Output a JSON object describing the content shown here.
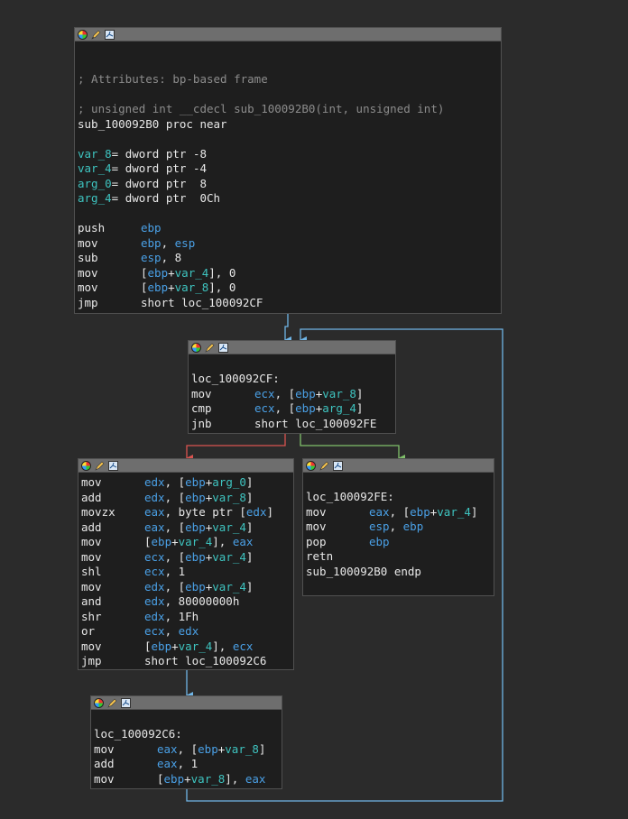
{
  "colors": {
    "background": "#2b2b2b",
    "block_bg": "#1e1e1e",
    "header_bg": "#6e6e6e",
    "comment": "#8c8c8c",
    "register": "#4aa0e6",
    "variable": "#3ec4c0",
    "edge_true": "#7fbf6a",
    "edge_false": "#d9534f",
    "edge_flow": "#6fb5e6"
  },
  "header_icons": [
    "color-picker-icon",
    "rename-icon",
    "graph-icon"
  ],
  "blocks": {
    "entry": {
      "comment_attr": "; Attributes: bp-based frame",
      "comment_sig": "; unsigned int __cdecl sub_100092B0(int, unsigned int)",
      "proc_line": "sub_100092B0 proc near",
      "vars": [
        {
          "name": "var_8",
          "def": "= dword ptr -8"
        },
        {
          "name": "var_4",
          "def": "= dword ptr -4"
        },
        {
          "name": "arg_0",
          "def": "= dword ptr  8"
        },
        {
          "name": "arg_4",
          "def": "= dword ptr  0Ch"
        }
      ],
      "lines": [
        {
          "mn": "push",
          "ops": [
            [
              "reg",
              "ebp"
            ]
          ]
        },
        {
          "mn": "mov",
          "ops": [
            [
              "reg",
              "ebp"
            ],
            [
              "t",
              ", "
            ],
            [
              "reg",
              "esp"
            ]
          ]
        },
        {
          "mn": "sub",
          "ops": [
            [
              "reg",
              "esp"
            ],
            [
              "t",
              ", 8"
            ]
          ]
        },
        {
          "mn": "mov",
          "ops": [
            [
              "t",
              "["
            ],
            [
              "reg",
              "ebp"
            ],
            [
              "t",
              "+"
            ],
            [
              "var",
              "var_4"
            ],
            [
              "t",
              "], 0"
            ]
          ]
        },
        {
          "mn": "mov",
          "ops": [
            [
              "t",
              "["
            ],
            [
              "reg",
              "ebp"
            ],
            [
              "t",
              "+"
            ],
            [
              "var",
              "var_8"
            ],
            [
              "t",
              "], 0"
            ]
          ]
        },
        {
          "mn": "jmp",
          "ops": [
            [
              "t",
              "short loc_100092CF"
            ]
          ]
        }
      ]
    },
    "loop_head": {
      "label": "loc_100092CF:",
      "lines": [
        {
          "mn": "mov",
          "ops": [
            [
              "reg",
              "ecx"
            ],
            [
              "t",
              ", ["
            ],
            [
              "reg",
              "ebp"
            ],
            [
              "t",
              "+"
            ],
            [
              "var",
              "var_8"
            ],
            [
              "t",
              "]"
            ]
          ]
        },
        {
          "mn": "cmp",
          "ops": [
            [
              "reg",
              "ecx"
            ],
            [
              "t",
              ", ["
            ],
            [
              "reg",
              "ebp"
            ],
            [
              "t",
              "+"
            ],
            [
              "var",
              "arg_4"
            ],
            [
              "t",
              "]"
            ]
          ]
        },
        {
          "mn": "jnb",
          "ops": [
            [
              "t",
              "short loc_100092FE"
            ]
          ]
        }
      ]
    },
    "body": {
      "lines": [
        {
          "mn": "mov",
          "ops": [
            [
              "reg",
              "edx"
            ],
            [
              "t",
              ", ["
            ],
            [
              "reg",
              "ebp"
            ],
            [
              "t",
              "+"
            ],
            [
              "var",
              "arg_0"
            ],
            [
              "t",
              "]"
            ]
          ]
        },
        {
          "mn": "add",
          "ops": [
            [
              "reg",
              "edx"
            ],
            [
              "t",
              ", ["
            ],
            [
              "reg",
              "ebp"
            ],
            [
              "t",
              "+"
            ],
            [
              "var",
              "var_8"
            ],
            [
              "t",
              "]"
            ]
          ]
        },
        {
          "mn": "movzx",
          "ops": [
            [
              "reg",
              "eax"
            ],
            [
              "t",
              ", byte ptr ["
            ],
            [
              "reg",
              "edx"
            ],
            [
              "t",
              "]"
            ]
          ]
        },
        {
          "mn": "add",
          "ops": [
            [
              "reg",
              "eax"
            ],
            [
              "t",
              ", ["
            ],
            [
              "reg",
              "ebp"
            ],
            [
              "t",
              "+"
            ],
            [
              "var",
              "var_4"
            ],
            [
              "t",
              "]"
            ]
          ]
        },
        {
          "mn": "mov",
          "ops": [
            [
              "t",
              "["
            ],
            [
              "reg",
              "ebp"
            ],
            [
              "t",
              "+"
            ],
            [
              "var",
              "var_4"
            ],
            [
              "t",
              "], "
            ],
            [
              "reg",
              "eax"
            ]
          ]
        },
        {
          "mn": "mov",
          "ops": [
            [
              "reg",
              "ecx"
            ],
            [
              "t",
              ", ["
            ],
            [
              "reg",
              "ebp"
            ],
            [
              "t",
              "+"
            ],
            [
              "var",
              "var_4"
            ],
            [
              "t",
              "]"
            ]
          ]
        },
        {
          "mn": "shl",
          "ops": [
            [
              "reg",
              "ecx"
            ],
            [
              "t",
              ", 1"
            ]
          ]
        },
        {
          "mn": "mov",
          "ops": [
            [
              "reg",
              "edx"
            ],
            [
              "t",
              ", ["
            ],
            [
              "reg",
              "ebp"
            ],
            [
              "t",
              "+"
            ],
            [
              "var",
              "var_4"
            ],
            [
              "t",
              "]"
            ]
          ]
        },
        {
          "mn": "and",
          "ops": [
            [
              "reg",
              "edx"
            ],
            [
              "t",
              ", 80000000h"
            ]
          ]
        },
        {
          "mn": "shr",
          "ops": [
            [
              "reg",
              "edx"
            ],
            [
              "t",
              ", 1Fh"
            ]
          ]
        },
        {
          "mn": "or",
          "ops": [
            [
              "reg",
              "ecx"
            ],
            [
              "t",
              ", "
            ],
            [
              "reg",
              "edx"
            ]
          ]
        },
        {
          "mn": "mov",
          "ops": [
            [
              "t",
              "["
            ],
            [
              "reg",
              "ebp"
            ],
            [
              "t",
              "+"
            ],
            [
              "var",
              "var_4"
            ],
            [
              "t",
              "], "
            ],
            [
              "reg",
              "ecx"
            ]
          ]
        },
        {
          "mn": "jmp",
          "ops": [
            [
              "t",
              "short loc_100092C6"
            ]
          ]
        }
      ]
    },
    "exit": {
      "label": "loc_100092FE:",
      "lines": [
        {
          "mn": "mov",
          "ops": [
            [
              "reg",
              "eax"
            ],
            [
              "t",
              ", ["
            ],
            [
              "reg",
              "ebp"
            ],
            [
              "t",
              "+"
            ],
            [
              "var",
              "var_4"
            ],
            [
              "t",
              "]"
            ]
          ]
        },
        {
          "mn": "mov",
          "ops": [
            [
              "reg",
              "esp"
            ],
            [
              "t",
              ", "
            ],
            [
              "reg",
              "ebp"
            ]
          ]
        },
        {
          "mn": "pop",
          "ops": [
            [
              "reg",
              "ebp"
            ]
          ]
        },
        {
          "mn": "retn",
          "ops": []
        }
      ],
      "endp_line": "sub_100092B0 endp"
    },
    "latch": {
      "label": "loc_100092C6:",
      "lines": [
        {
          "mn": "mov",
          "ops": [
            [
              "reg",
              "eax"
            ],
            [
              "t",
              ", ["
            ],
            [
              "reg",
              "ebp"
            ],
            [
              "t",
              "+"
            ],
            [
              "var",
              "var_8"
            ],
            [
              "t",
              "]"
            ]
          ]
        },
        {
          "mn": "add",
          "ops": [
            [
              "reg",
              "eax"
            ],
            [
              "t",
              ", 1"
            ]
          ]
        },
        {
          "mn": "mov",
          "ops": [
            [
              "t",
              "["
            ],
            [
              "reg",
              "ebp"
            ],
            [
              "t",
              "+"
            ],
            [
              "var",
              "var_8"
            ],
            [
              "t",
              "], "
            ],
            [
              "reg",
              "eax"
            ]
          ]
        }
      ]
    }
  }
}
